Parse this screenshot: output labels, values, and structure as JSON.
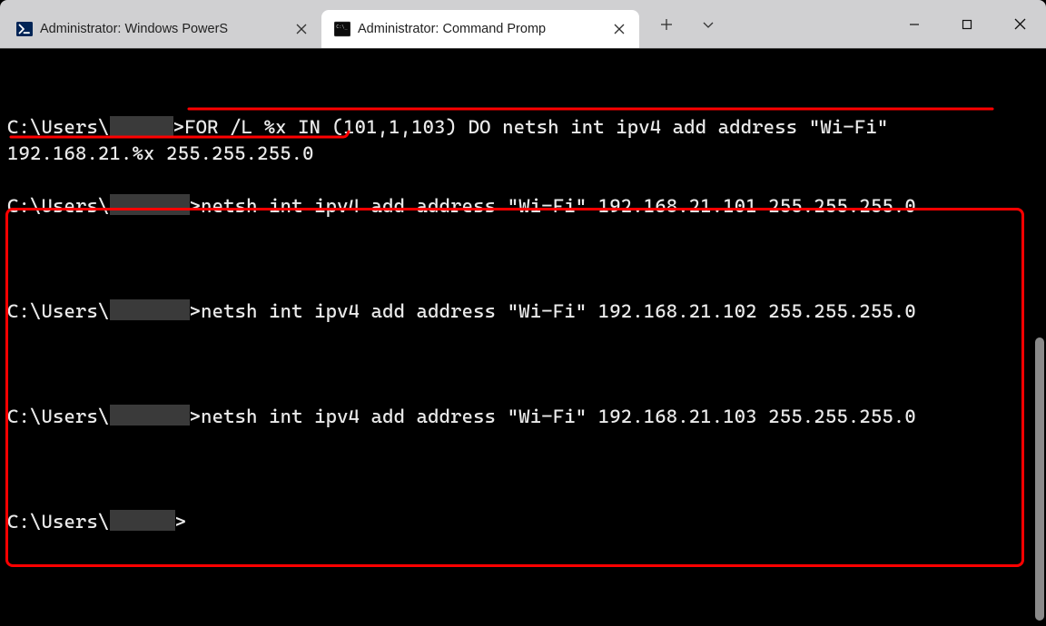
{
  "tabs": {
    "inactive": {
      "title": "Administrator: Windows PowerS"
    },
    "active": {
      "title": "Administrator: Command Promp"
    }
  },
  "terminal": {
    "prompt_prefix": "C:\\Users\\",
    "prompt_suffix": ">",
    "command_line1": "FOR /L %x IN (101,1,103) DO netsh int ipv4 add address \"Wi-Fi\"",
    "command_line2": "192.168.21.%x 255.255.255.0",
    "out1": "netsh int ipv4 add address \"Wi-Fi\" 192.168.21.101 255.255.255.0",
    "out2": "netsh int ipv4 add address \"Wi-Fi\" 192.168.21.102 255.255.255.0",
    "out3": "netsh int ipv4 add address \"Wi-Fi\" 192.168.21.103 255.255.255.0"
  },
  "redaction": {
    "w1": 70,
    "h1": 22,
    "w2": 88,
    "h2": 23,
    "w3": 72,
    "h3": 23
  },
  "icons": {
    "powershell_bg": "#012456",
    "powershell_accent": "#ffffff",
    "cmd_bg": "#0c0c0c",
    "cmd_fg": "#cccccc"
  }
}
